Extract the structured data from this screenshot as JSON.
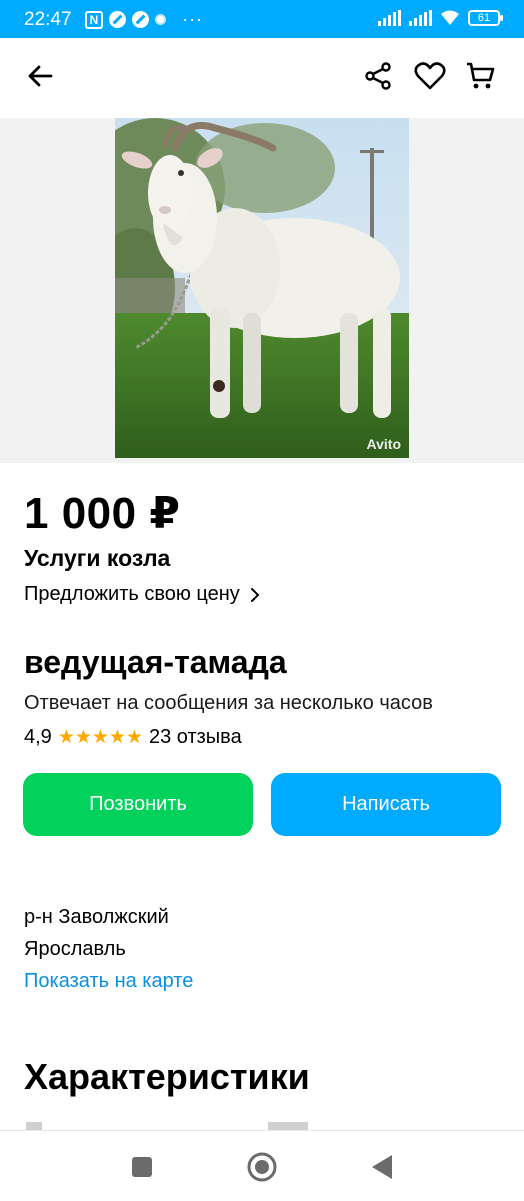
{
  "status_bar": {
    "time": "22:47",
    "battery": "61",
    "more": "···"
  },
  "toolbar": {
    "back_icon": "arrow-left-icon",
    "share_icon": "share-icon",
    "favorite_icon": "heart-icon",
    "cart_icon": "cart-icon"
  },
  "listing": {
    "watermark": "Avito",
    "price": "1 000 ₽",
    "title": "Услуги козла",
    "offer_price_label": "Предложить свою цену"
  },
  "seller": {
    "name": "ведущая-тамада",
    "reply_time": "Отвечает на сообщения за несколько часов",
    "rating": "4,9",
    "stars": "★★★★★",
    "reviews": "23 отзыва"
  },
  "actions": {
    "call_label": "Позвонить",
    "write_label": "Написать"
  },
  "location": {
    "district": "р-н Заволжский",
    "city": "Ярославль",
    "map_link": "Показать на карте"
  },
  "characteristics": {
    "heading": "Характеристики"
  },
  "colors": {
    "accent_blue": "#00aaff",
    "call_green": "#02d15c",
    "link_blue": "#0a8fe0",
    "star": "#ffa800"
  }
}
